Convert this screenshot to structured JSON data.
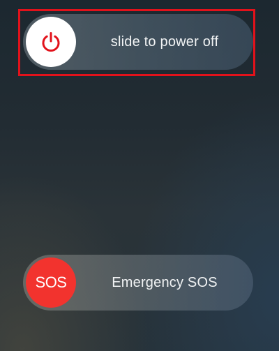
{
  "power_slider": {
    "label": "slide to power off",
    "knob_icon": "power-icon",
    "knob_icon_color": "#e2121b",
    "knob_color": "#ffffff"
  },
  "sos_slider": {
    "knob_label": "SOS",
    "label": "Emergency SOS",
    "knob_color": "#f2332e"
  },
  "highlight": {
    "color": "#e2121b"
  }
}
